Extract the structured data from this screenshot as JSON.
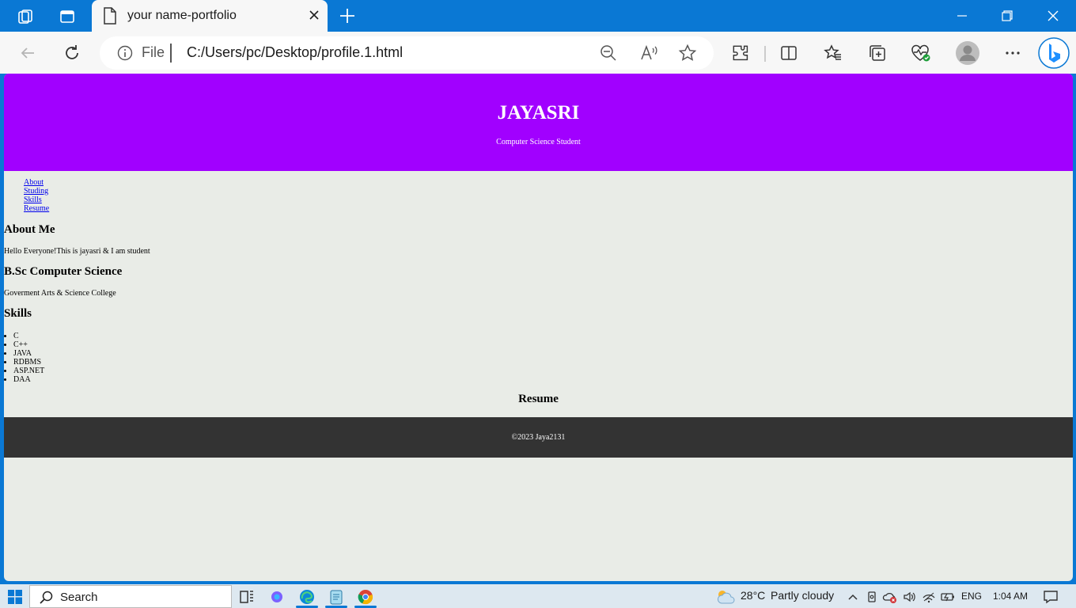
{
  "browser": {
    "tab_title": "your name-portfolio",
    "address_scheme": "File",
    "address_url": "C:/Users/pc/Desktop/profile.1.html"
  },
  "page": {
    "header_name": "JAYASRI",
    "header_subtitle": "Computer Science Student",
    "nav": [
      "About",
      "Studing",
      "Skills",
      "Resume"
    ],
    "about_heading": "About Me",
    "about_text": "Hello Everyone!This is jayasri & I am student",
    "edu_heading": "B.Sc Computer Science",
    "edu_text": "Goverment Arts & Science College",
    "skills_heading": "Skills",
    "skills": [
      "C",
      "C++",
      "JAVA",
      "RDBMS",
      "ASP.NET",
      "DAA"
    ],
    "resume_heading": "Resume",
    "footer_text": "©2023 Jaya2131",
    "header_color": "#a100ff",
    "footer_color": "#333333",
    "body_bg": "#e9ece7"
  },
  "taskbar": {
    "search_label": "Search",
    "weather_temp": "28°C",
    "weather_desc": "Partly cloudy",
    "language": "ENG",
    "time": "1:04 AM"
  },
  "colors": {
    "accent": "#0a78d4",
    "taskbar_bg": "#dde8f0"
  }
}
